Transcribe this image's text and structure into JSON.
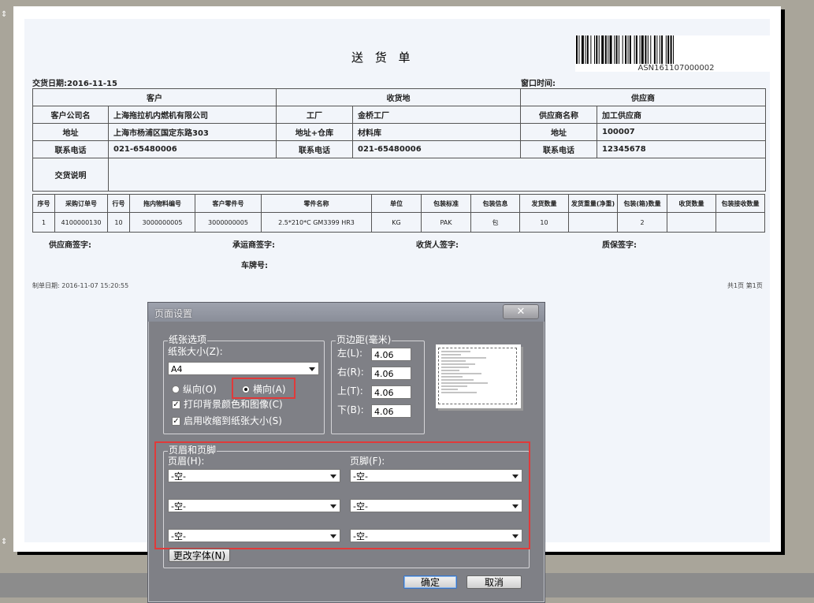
{
  "document": {
    "title": "送 货 单",
    "barcode_text": "ASN161107000002",
    "delivery_date": "交货日期:2016-11-15",
    "window_time": "窗口时间:",
    "section_headers": [
      "客户",
      "收货地",
      "供应商"
    ],
    "info_rows": [
      [
        "客户公司名",
        "上海拖拉机内燃机有限公司",
        "工厂",
        "金桥工厂",
        "供应商名称",
        "加工供应商"
      ],
      [
        "地址",
        "上海市杨浦区国定东路303",
        "地址+仓库",
        "材料库",
        "地址",
        "100007"
      ],
      [
        "联系电话",
        "021-65480006",
        "联系电话",
        "021-65480006",
        "联系电话",
        "12345678"
      ]
    ],
    "remarks_label": "交货说明",
    "item_headers": [
      "序号",
      "采购订单号",
      "行号",
      "拖内物料编号",
      "客户零件号",
      "零件名称",
      "单位",
      "包装标准",
      "包装信息",
      "发货数量",
      "发货重量(净重)",
      "包装(箱)数量",
      "收货数量",
      "包装接收数量"
    ],
    "item_rows": [
      [
        "1",
        "4100000130",
        "10",
        "3000000005",
        "3000000005",
        "2.5*210*C GM3399 HR3",
        "KG",
        "PAK",
        "包",
        "10",
        "",
        "2",
        "",
        ""
      ]
    ],
    "signatures": {
      "supplier": "供应商签字:",
      "carrier": "承运商签字:",
      "receiver": "收货人签字:",
      "qa": "质保签字:",
      "plate": "车牌号:"
    },
    "print_date": "制单日期: 2016-11-07 15:20:55",
    "page_info": "共1页  第1页"
  },
  "dialog": {
    "title": "页面设置",
    "close_label": "✕",
    "paper_group_label": "纸张选项",
    "paper_size_label": "纸张大小(Z):",
    "paper_size_value": "A4",
    "portrait_label": "纵向(O)",
    "landscape_label": "横向(A)",
    "orientation_selected": "landscape",
    "print_bg_label": "打印背景颜色和图像(C)",
    "print_bg_checked": true,
    "shrink_label": "启用收缩到纸张大小(S)",
    "shrink_checked": true,
    "margins_group_label": "页边距(毫米)",
    "margins": [
      {
        "label": "左(L):",
        "value": "4.06"
      },
      {
        "label": "右(R):",
        "value": "4.06"
      },
      {
        "label": "上(T):",
        "value": "4.06"
      },
      {
        "label": "下(B):",
        "value": "4.06"
      }
    ],
    "header_footer_group_label": "页眉和页脚",
    "header_label": "页眉(H):",
    "footer_label": "页脚(F):",
    "header_values": [
      "-空-",
      "-空-",
      "-空-"
    ],
    "footer_values": [
      "-空-",
      "-空-",
      "-空-"
    ],
    "change_font_label": "更改字体(N)",
    "ok_label": "确定",
    "cancel_label": "取消"
  },
  "colors": {
    "highlight": "#e03a3a",
    "dialog_bg": "#7f8086",
    "desktop_bg": "#a9a59a"
  }
}
